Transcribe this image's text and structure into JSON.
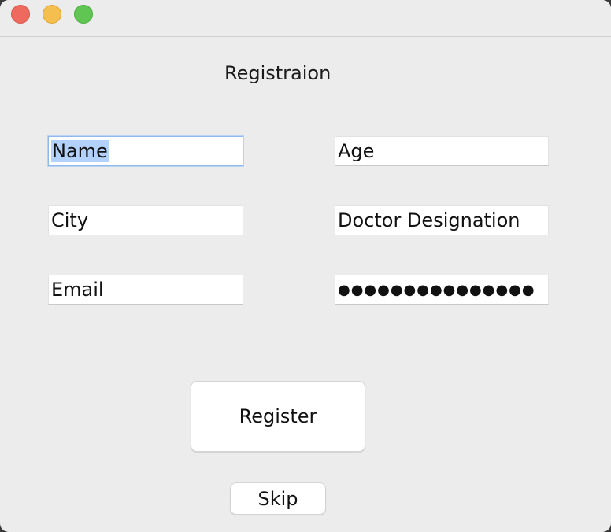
{
  "window": {
    "title": "Registraion"
  },
  "form": {
    "name": "Name",
    "age": "Age",
    "city": "City",
    "doctor_designation": "Doctor Designation",
    "email": "Email",
    "password_mask": "●●●●●●●●●●●●●●●"
  },
  "buttons": {
    "register": "Register",
    "skip": "Skip"
  },
  "colors": {
    "close": "#ee6a5f",
    "minimize": "#f5bf4f",
    "maximize": "#61c554",
    "focus_ring": "#8fb8ef",
    "selection": "#b3d2fb"
  }
}
